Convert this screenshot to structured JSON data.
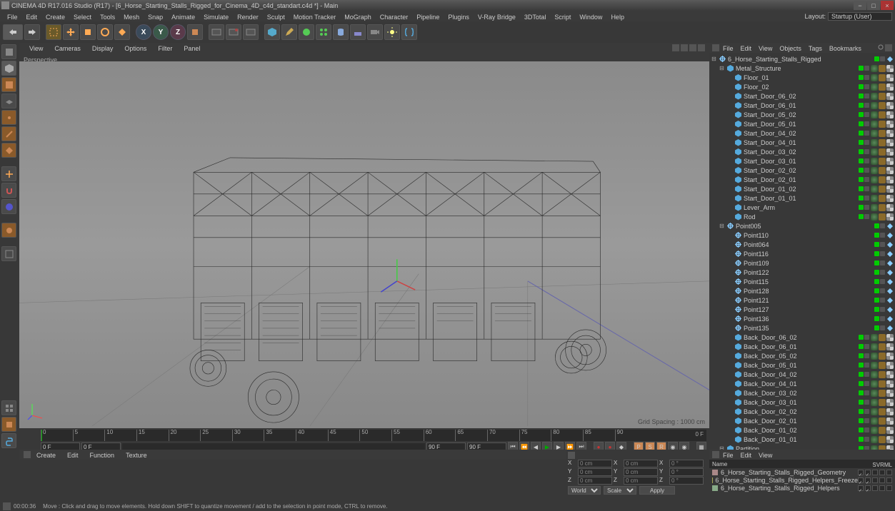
{
  "title": "CINEMA 4D R17.016 Studio (R17) - [6_Horse_Starting_Stalls_Rigged_for_Cinema_4D_c4d_standart.c4d *] - Main",
  "menubar": [
    "File",
    "Edit",
    "Create",
    "Select",
    "Tools",
    "Mesh",
    "Snap",
    "Animate",
    "Simulate",
    "Render",
    "Sculpt",
    "Motion Tracker",
    "MoGraph",
    "Character",
    "Pipeline",
    "Plugins",
    "V-Ray Bridge",
    "3DTotal",
    "Script",
    "Window",
    "Help"
  ],
  "layout": {
    "label": "Layout:",
    "value": "Startup (User)"
  },
  "viewport": {
    "menu": [
      "View",
      "Cameras",
      "Display",
      "Options",
      "Filter",
      "Panel"
    ],
    "label": "Perspective",
    "grid_spacing": "Grid Spacing : 1000 cm"
  },
  "timeline": {
    "ticks": [
      "0",
      "5",
      "10",
      "15",
      "20",
      "25",
      "30",
      "35",
      "40",
      "45",
      "50",
      "55",
      "60",
      "65",
      "70",
      "75",
      "80",
      "85",
      "90"
    ],
    "end_label": "0 F",
    "start_field": "0 F",
    "range_field": "0 F",
    "end_field1": "90 F",
    "end_field2": "90 F"
  },
  "material_menu": [
    "Create",
    "Edit",
    "Function",
    "Texture"
  ],
  "coord": {
    "x_pos": "0 cm",
    "x_size": "0 cm",
    "x_rot": "0 °",
    "y_pos": "0 cm",
    "y_size": "0 cm",
    "y_rot": "0 °",
    "z_pos": "0 cm",
    "z_size": "0 cm",
    "z_rot": "0 °",
    "select1": "World",
    "select2": "Scale",
    "apply": "Apply"
  },
  "objects": {
    "menu": [
      "File",
      "Edit",
      "View",
      "Objects",
      "Tags",
      "Bookmarks"
    ],
    "items": [
      {
        "indent": 0,
        "icon": "null",
        "type": "null",
        "label": "6_Horse_Starting_Stalls_Rigged",
        "tags": 0
      },
      {
        "indent": 1,
        "icon": "poly",
        "type": "poly",
        "label": "Metal_Structure",
        "tags": 3
      },
      {
        "indent": 2,
        "icon": "poly",
        "type": "poly",
        "label": "Floor_01",
        "tags": 3
      },
      {
        "indent": 2,
        "icon": "poly",
        "type": "poly",
        "label": "Floor_02",
        "tags": 3
      },
      {
        "indent": 2,
        "icon": "poly",
        "type": "poly",
        "label": "Start_Door_06_02",
        "tags": 3
      },
      {
        "indent": 2,
        "icon": "poly",
        "type": "poly",
        "label": "Start_Door_06_01",
        "tags": 3
      },
      {
        "indent": 2,
        "icon": "poly",
        "type": "poly",
        "label": "Start_Door_05_02",
        "tags": 3
      },
      {
        "indent": 2,
        "icon": "poly",
        "type": "poly",
        "label": "Start_Door_05_01",
        "tags": 3
      },
      {
        "indent": 2,
        "icon": "poly",
        "type": "poly",
        "label": "Start_Door_04_02",
        "tags": 3
      },
      {
        "indent": 2,
        "icon": "poly",
        "type": "poly",
        "label": "Start_Door_04_01",
        "tags": 3
      },
      {
        "indent": 2,
        "icon": "poly",
        "type": "poly",
        "label": "Start_Door_03_02",
        "tags": 3
      },
      {
        "indent": 2,
        "icon": "poly",
        "type": "poly",
        "label": "Start_Door_03_01",
        "tags": 3
      },
      {
        "indent": 2,
        "icon": "poly",
        "type": "poly",
        "label": "Start_Door_02_02",
        "tags": 3
      },
      {
        "indent": 2,
        "icon": "poly",
        "type": "poly",
        "label": "Start_Door_02_01",
        "tags": 3
      },
      {
        "indent": 2,
        "icon": "poly",
        "type": "poly",
        "label": "Start_Door_01_02",
        "tags": 3
      },
      {
        "indent": 2,
        "icon": "poly",
        "type": "poly",
        "label": "Start_Door_01_01",
        "tags": 3
      },
      {
        "indent": 2,
        "icon": "poly",
        "type": "poly",
        "label": "Lever_Arm",
        "tags": 3
      },
      {
        "indent": 2,
        "icon": "poly",
        "type": "poly",
        "label": "Rod",
        "tags": 3
      },
      {
        "indent": 1,
        "icon": "null",
        "type": "null",
        "label": "Point005",
        "tags": 0
      },
      {
        "indent": 2,
        "icon": "null",
        "type": "null",
        "label": "Point110",
        "tags": 0
      },
      {
        "indent": 2,
        "icon": "null",
        "type": "null",
        "label": "Point064",
        "tags": 0
      },
      {
        "indent": 2,
        "icon": "null",
        "type": "null",
        "label": "Point116",
        "tags": 0
      },
      {
        "indent": 2,
        "icon": "null",
        "type": "null",
        "label": "Point109",
        "tags": 0
      },
      {
        "indent": 2,
        "icon": "null",
        "type": "null",
        "label": "Point122",
        "tags": 0
      },
      {
        "indent": 2,
        "icon": "null",
        "type": "null",
        "label": "Point115",
        "tags": 0
      },
      {
        "indent": 2,
        "icon": "null",
        "type": "null",
        "label": "Point128",
        "tags": 0
      },
      {
        "indent": 2,
        "icon": "null",
        "type": "null",
        "label": "Point121",
        "tags": 0
      },
      {
        "indent": 2,
        "icon": "null",
        "type": "null",
        "label": "Point127",
        "tags": 0
      },
      {
        "indent": 2,
        "icon": "null",
        "type": "null",
        "label": "Point136",
        "tags": 0
      },
      {
        "indent": 2,
        "icon": "null",
        "type": "null",
        "label": "Point135",
        "tags": 0
      },
      {
        "indent": 2,
        "icon": "poly",
        "type": "poly",
        "label": "Back_Door_06_02",
        "tags": 3
      },
      {
        "indent": 2,
        "icon": "poly",
        "type": "poly",
        "label": "Back_Door_06_01",
        "tags": 3
      },
      {
        "indent": 2,
        "icon": "poly",
        "type": "poly",
        "label": "Back_Door_05_02",
        "tags": 3
      },
      {
        "indent": 2,
        "icon": "poly",
        "type": "poly",
        "label": "Back_Door_05_01",
        "tags": 3
      },
      {
        "indent": 2,
        "icon": "poly",
        "type": "poly",
        "label": "Back_Door_04_02",
        "tags": 3
      },
      {
        "indent": 2,
        "icon": "poly",
        "type": "poly",
        "label": "Back_Door_04_01",
        "tags": 3
      },
      {
        "indent": 2,
        "icon": "poly",
        "type": "poly",
        "label": "Back_Door_03_02",
        "tags": 3
      },
      {
        "indent": 2,
        "icon": "poly",
        "type": "poly",
        "label": "Back_Door_03_01",
        "tags": 3
      },
      {
        "indent": 2,
        "icon": "poly",
        "type": "poly",
        "label": "Back_Door_02_02",
        "tags": 3
      },
      {
        "indent": 2,
        "icon": "poly",
        "type": "poly",
        "label": "Back_Door_02_01",
        "tags": 3
      },
      {
        "indent": 2,
        "icon": "poly",
        "type": "poly",
        "label": "Back_Door_01_02",
        "tags": 3
      },
      {
        "indent": 2,
        "icon": "poly",
        "type": "poly",
        "label": "Back_Door_01_01",
        "tags": 3
      },
      {
        "indent": 1,
        "icon": "poly",
        "type": "poly",
        "label": "Partition",
        "tags": 3
      }
    ]
  },
  "attributes": {
    "menu": [
      "File",
      "Edit",
      "View"
    ],
    "header_name": "Name",
    "header_cols": [
      "S",
      "V",
      "R",
      "M",
      "L"
    ],
    "rows": [
      {
        "color": "#a88",
        "name": "6_Horse_Starting_Stalls_Rigged_Geometry"
      },
      {
        "color": "#aa5",
        "name": "6_Horse_Starting_Stalls_Rigged_Helpers_Freeze"
      },
      {
        "color": "#8a8",
        "name": "6_Horse_Starting_Stalls_Rigged_Helpers"
      }
    ]
  },
  "status": {
    "time": "00:00:36",
    "hint": "Move : Click and drag to move elements. Hold down SHIFT to quantize movement / add to the selection in point mode, CTRL to remove."
  }
}
